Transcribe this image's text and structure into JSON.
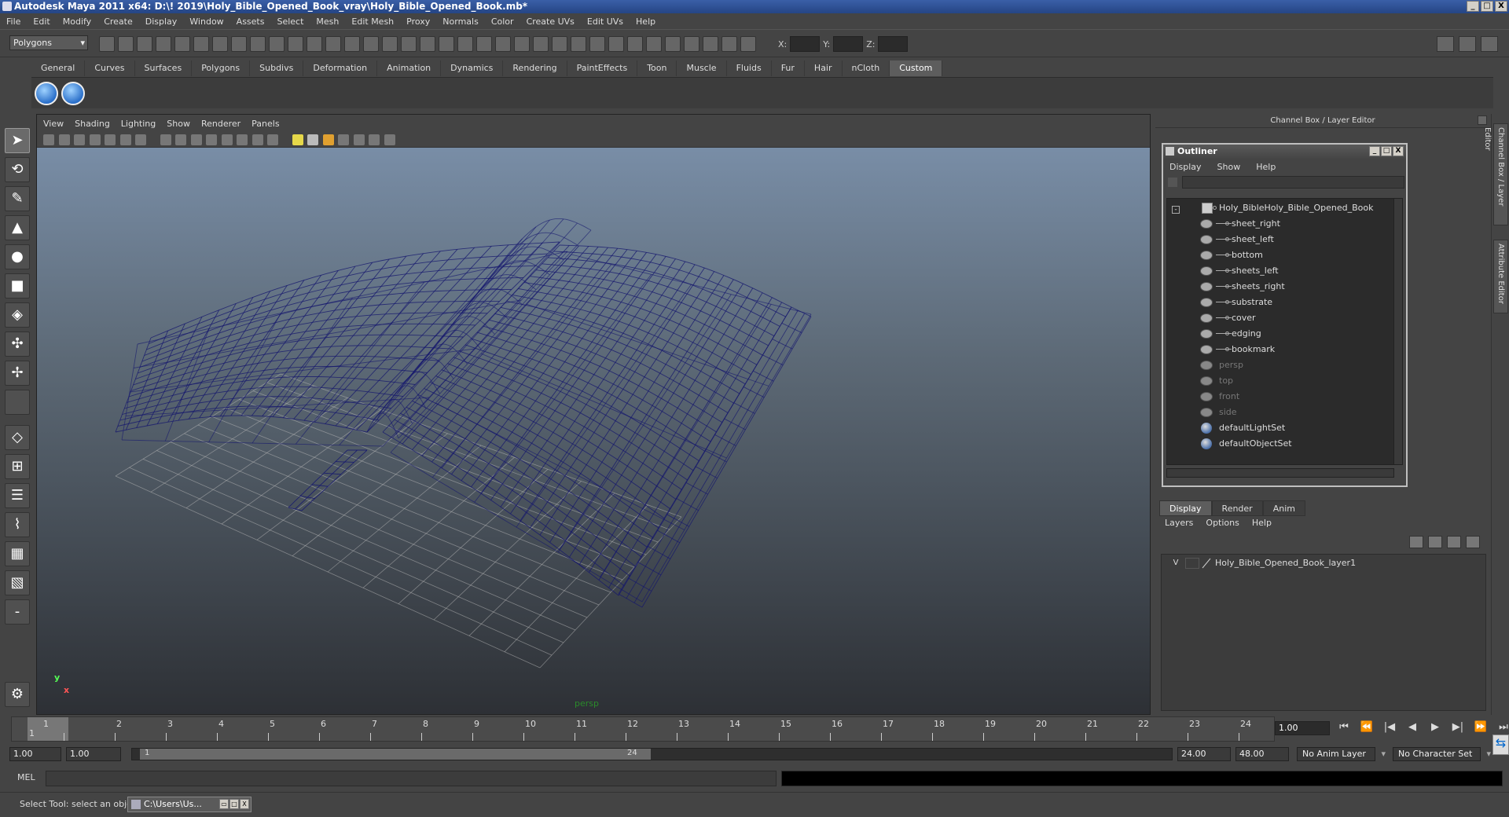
{
  "app": {
    "title": "Autodesk Maya 2011 x64: D:\\! 2019\\Holy_Bible_Opened_Book_vray\\Holy_Bible_Opened_Book.mb*",
    "win_min": "_",
    "win_max": "□",
    "win_close": "X"
  },
  "menu": [
    "File",
    "Edit",
    "Modify",
    "Create",
    "Display",
    "Window",
    "Assets",
    "Select",
    "Mesh",
    "Edit Mesh",
    "Proxy",
    "Normals",
    "Color",
    "Create UVs",
    "Edit UVs",
    "Help"
  ],
  "toolbar": {
    "mode": "Polygons",
    "x_label": "X:",
    "y_label": "Y:",
    "z_label": "Z:"
  },
  "shelf_tabs": [
    {
      "label": "General"
    },
    {
      "label": "Curves"
    },
    {
      "label": "Surfaces"
    },
    {
      "label": "Polygons"
    },
    {
      "label": "Subdivs"
    },
    {
      "label": "Deformation"
    },
    {
      "label": "Animation"
    },
    {
      "label": "Dynamics"
    },
    {
      "label": "Rendering"
    },
    {
      "label": "PaintEffects"
    },
    {
      "label": "Toon"
    },
    {
      "label": "Muscle"
    },
    {
      "label": "Fluids"
    },
    {
      "label": "Fur"
    },
    {
      "label": "Hair"
    },
    {
      "label": "nCloth"
    },
    {
      "label": "Custom",
      "active": true
    }
  ],
  "viewport": {
    "menu": [
      "View",
      "Shading",
      "Lighting",
      "Show",
      "Renderer",
      "Panels"
    ],
    "camera_label": "persp",
    "axis_y": "y",
    "axis_x": "x",
    "wire_color": "#14166e",
    "grid_color": "#b8b8b8"
  },
  "channel_box": {
    "title": "Channel Box / Layer Editor"
  },
  "outliner": {
    "title": "Outliner",
    "menu": [
      "Display",
      "Show",
      "Help"
    ],
    "root": "Holy_BibleHoly_Bible_Opened_Book",
    "children": [
      "sheet_right",
      "sheet_left",
      "bottom",
      "sheets_left",
      "sheets_right",
      "substrate",
      "cover",
      "edging",
      "bookmark"
    ],
    "cameras": [
      "persp",
      "top",
      "front",
      "side"
    ],
    "sets": [
      "defaultLightSet",
      "defaultObjectSet"
    ]
  },
  "layer_editor": {
    "tabs": [
      {
        "label": "Display",
        "active": true
      },
      {
        "label": "Render"
      },
      {
        "label": "Anim"
      }
    ],
    "menu": [
      "Layers",
      "Options",
      "Help"
    ],
    "layer_visible": "V",
    "layer_name": "Holy_Bible_Opened_Book_layer1"
  },
  "side_tabs": [
    "Channel Box / Layer Editor",
    "Attribute Editor"
  ],
  "timeline": {
    "frames": [
      "1",
      "2",
      "3",
      "4",
      "5",
      "6",
      "7",
      "8",
      "9",
      "10",
      "11",
      "12",
      "13",
      "14",
      "15",
      "16",
      "17",
      "18",
      "19",
      "20",
      "21",
      "22",
      "23",
      "24"
    ],
    "current_frame_marker": "1",
    "current_time": "1.00"
  },
  "range": {
    "start_time": "1.00",
    "range_start": "1.00",
    "slider_start": "1",
    "slider_end": "24",
    "range_end": "24.00",
    "end_time": "48.00",
    "anim_layer": "No Anim Layer",
    "char_set": "No Character Set"
  },
  "command": {
    "label": "MEL"
  },
  "status": {
    "help_line": "Select Tool: select an object",
    "task_label": "C:\\Users\\Us..."
  }
}
